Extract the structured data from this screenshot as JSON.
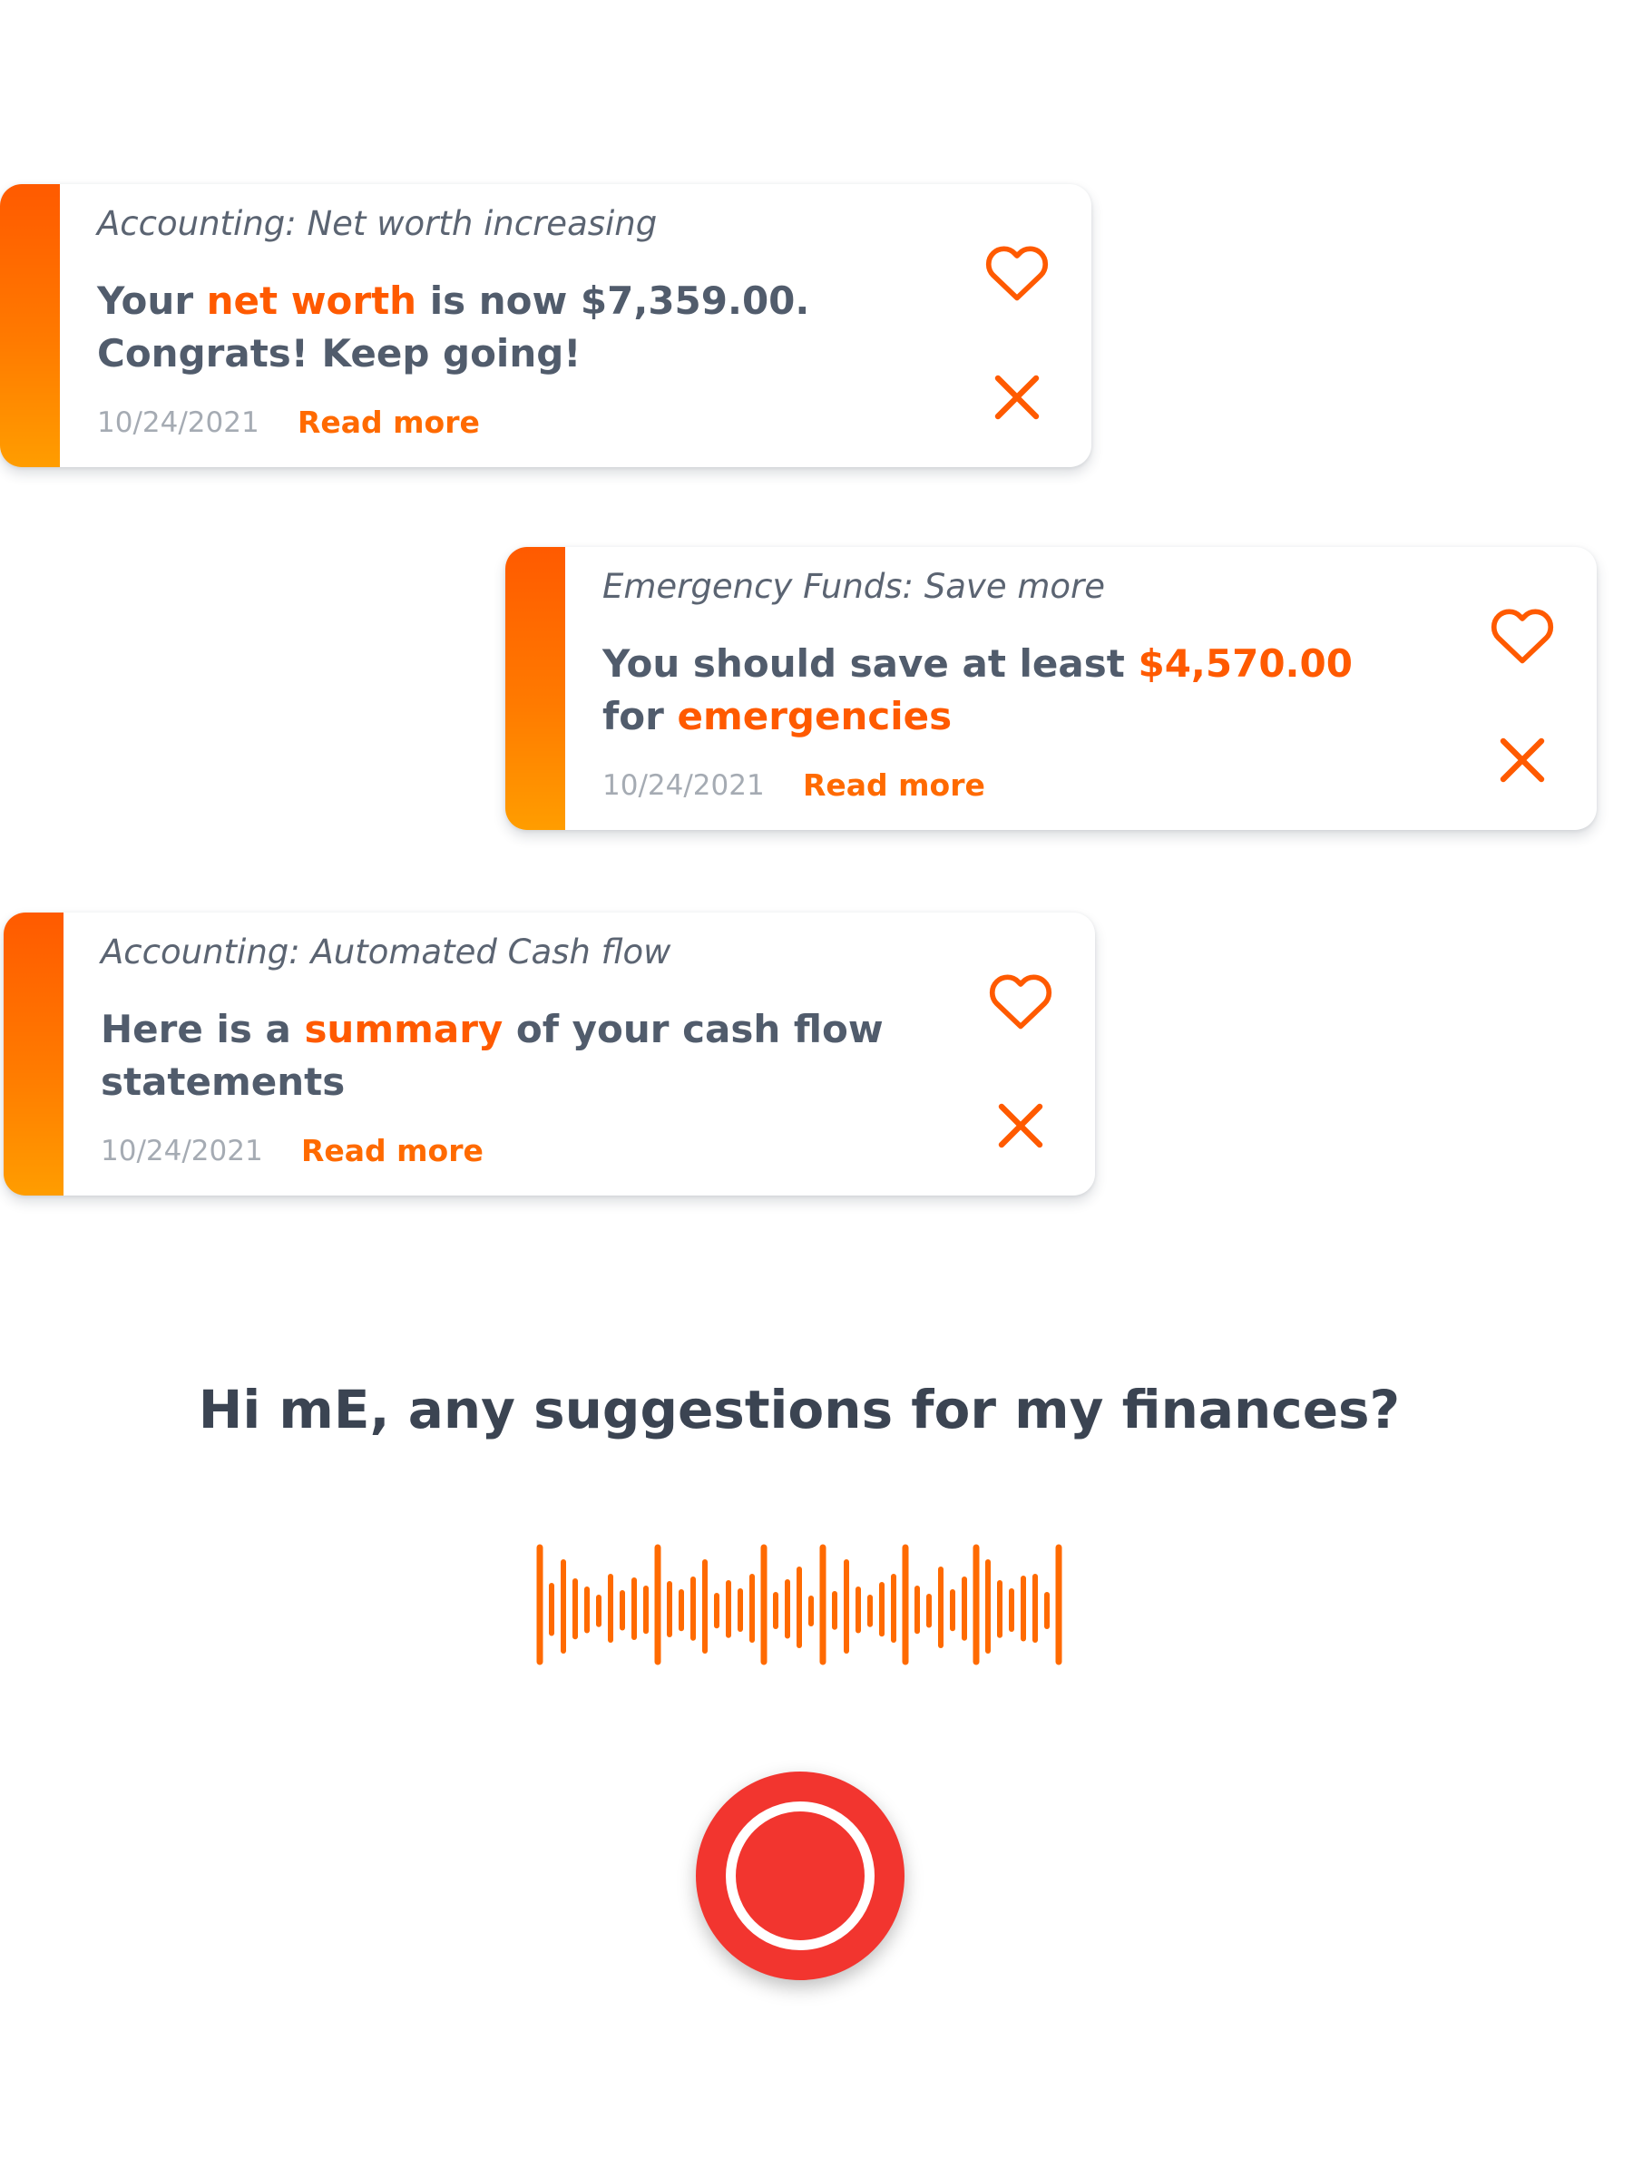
{
  "accent_color": "#ff5a00",
  "record_color": "#f2352f",
  "cards": [
    {
      "category": "Accounting: Net worth increasing",
      "message": [
        {
          "text": "Your ",
          "highlight": false
        },
        {
          "text": "net worth",
          "highlight": true
        },
        {
          "text": " is now $7,359.00. Congrats! Keep going!",
          "highlight": false
        }
      ],
      "date": "10/24/2021",
      "read_more": "Read more",
      "like_icon": "heart-outline-icon",
      "dismiss_icon": "close-icon"
    },
    {
      "category": "Emergency Funds: Save more",
      "message": [
        {
          "text": "You should save at least ",
          "highlight": false
        },
        {
          "text": "$4,570.00",
          "highlight": true
        },
        {
          "text": " for ",
          "highlight": false
        },
        {
          "text": "emergencies",
          "highlight": true
        }
      ],
      "date": "10/24/2021",
      "read_more": "Read more",
      "like_icon": "heart-outline-icon",
      "dismiss_icon": "close-icon"
    },
    {
      "category": "Accounting: Automated Cash flow",
      "message": [
        {
          "text": "Here is a ",
          "highlight": false
        },
        {
          "text": "summary",
          "highlight": true
        },
        {
          "text": " of your cash flow statements",
          "highlight": false
        }
      ],
      "date": "10/24/2021",
      "read_more": "Read more",
      "like_icon": "heart-outline-icon",
      "dismiss_icon": "close-icon"
    }
  ],
  "voice": {
    "question": "Hi mE, any suggestions for my finances?",
    "waveform_icon": "audio-waveform-icon",
    "record_icon": "record-button-icon"
  }
}
